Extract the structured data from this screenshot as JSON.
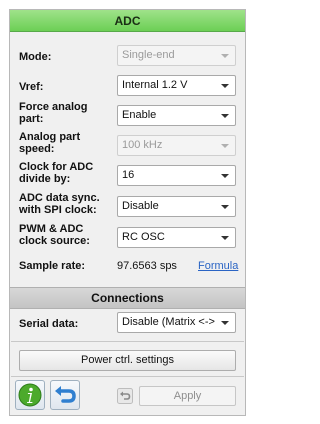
{
  "adc": {
    "title": "ADC",
    "mode": {
      "label": "Mode:",
      "value": "Single-end"
    },
    "vref": {
      "label": "Vref:",
      "value": "Internal 1.2 V"
    },
    "force_analog": {
      "label_line1": "Force analog",
      "label_line2": "part:",
      "value": "Enable"
    },
    "analog_speed": {
      "label_line1": "Analog part",
      "label_line2": "speed:",
      "value": "100 kHz"
    },
    "clock_divide": {
      "label_line1": "Clock for ADC",
      "label_line2": "divide by:",
      "value": "16"
    },
    "data_sync": {
      "label_line1": "ADC data sync.",
      "label_line2": "with SPI clock:",
      "value": "Disable"
    },
    "pwm_clock": {
      "label_line1": "PWM & ADC",
      "label_line2": "clock source:",
      "value": "RC OSC"
    },
    "sample_rate": {
      "label": "Sample rate:",
      "value": "97.6563 sps",
      "link": "Formula"
    }
  },
  "connections": {
    "title": "Connections",
    "serial_data": {
      "label": "Serial data:",
      "value": "Disable (Matrix <->"
    }
  },
  "footer": {
    "power_button": "Power ctrl. settings",
    "apply_button": "Apply"
  },
  "icons": {
    "info": "info-icon",
    "back": "back-arrow-icon",
    "undo": "undo-icon"
  },
  "colors": {
    "header_green": "#6ccf55",
    "info_green": "#4caa2c",
    "back_blue": "#2f7fd0",
    "link_blue": "#2a64c4"
  }
}
